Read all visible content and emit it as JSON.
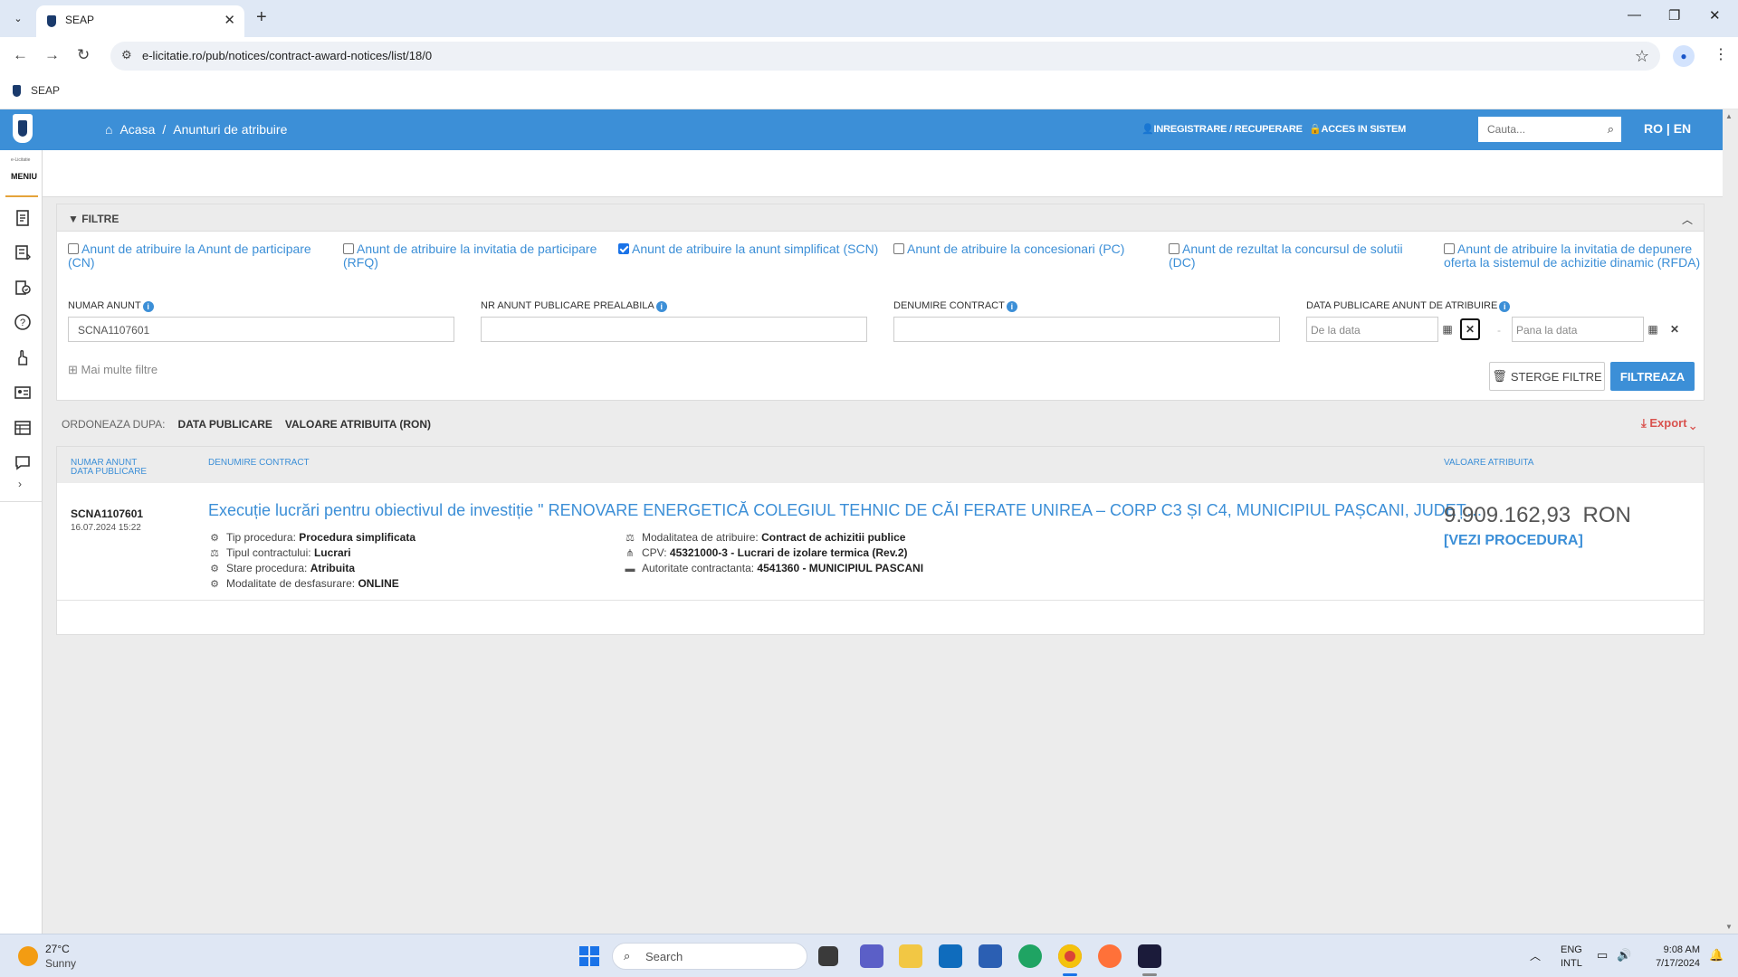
{
  "browser": {
    "tab_title": "SEAP",
    "url": "e-licitatie.ro/pub/notices/contract-award-notices/list/18/0",
    "bookmark": "SEAP"
  },
  "header": {
    "breadcrumb_home": "Acasa",
    "breadcrumb_sep": "/",
    "breadcrumb_current": "Anunturi de atribuire",
    "register_link": "INREGISTRARE / RECUPERARE",
    "login_link": "ACCES IN SISTEM",
    "search_placeholder": "Cauta...",
    "language": "RO | EN"
  },
  "sidebar": {
    "small_text": "e-Licitatie",
    "menu_label": "MENIU"
  },
  "filters": {
    "title": "FILTRE",
    "checkboxes": [
      {
        "label": "Anunt de atribuire la Anunt de participare (CN)",
        "checked": false
      },
      {
        "label": "Anunt de atribuire la invitatia de participare (RFQ)",
        "checked": false
      },
      {
        "label": "Anunt de atribuire la anunt simplificat (SCN)",
        "checked": true
      },
      {
        "label": "Anunt de atribuire la concesionari (PC)",
        "checked": false
      },
      {
        "label": "Anunt de rezultat la concursul de solutii (DC)",
        "checked": false
      },
      {
        "label": "Anunt de atribuire la invitatia de depunere oferta la sistemul de achizitie dinamic (RFDA)",
        "checked": false
      }
    ],
    "fields": {
      "numar_anunt_label": "NUMAR ANUNT",
      "numar_anunt_value": "SCNA1107601",
      "nr_prealabil_label": "NR ANUNT PUBLICARE PREALABILA",
      "nr_prealabil_value": "",
      "denumire_label": "DENUMIRE CONTRACT",
      "denumire_value": "",
      "data_label": "DATA PUBLICARE ANUNT DE ATRIBUIRE",
      "date_from_placeholder": "De la data",
      "date_to_placeholder": "Pana la data",
      "date_dash": "-"
    },
    "more_filters": "Mai multe filtre",
    "clear_button": "STERGE FILTRE",
    "filter_button": "FILTREAZA"
  },
  "sort": {
    "label": "ORDONEAZA DUPA:",
    "option1": "DATA PUBLICARE",
    "option2": "VALOARE ATRIBUITA (RON)",
    "export": "Export"
  },
  "results": {
    "col1_line1": "NUMAR ANUNT",
    "col1_line2": "DATA PUBLICARE",
    "col2": "DENUMIRE CONTRACT",
    "col3": "VALOARE ATRIBUITA",
    "rows": [
      {
        "number": "SCNA1107601",
        "date": "16.07.2024 15:22",
        "title": "Execuție lucrări pentru obiectivul de investiție \" RENOVARE ENERGETICĂ COLEGIUL TEHNIC DE CĂI FERATE UNIREA – CORP C3 ȘI C4, MUNICIPIUL PAȘCANI, JUDEȚUL IAȘI\"",
        "tip_procedura_label": "Tip procedura:",
        "tip_procedura": "Procedura simplificata",
        "tip_contract_label": "Tipul contractului:",
        "tip_contract": "Lucrari",
        "stare_label": "Stare procedura:",
        "stare": "Atribuita",
        "modalitate_desf_label": "Modalitate de desfasurare:",
        "modalitate_desf": "ONLINE",
        "modalitate_atr_label": "Modalitatea de atribuire:",
        "modalitate_atr": "Contract de achizitii publice",
        "cpv_label": "CPV:",
        "cpv": "45321000-3 - Lucrari de izolare termica (Rev.2)",
        "autoritate_label": "Autoritate contractanta:",
        "autoritate": "4541360 - MUNICIPIUL PASCANI",
        "value": "9.909.162,93",
        "currency": "RON",
        "procedure_link": "[VEZI PROCEDURA]"
      }
    ]
  },
  "taskbar": {
    "temperature": "27°C",
    "weather": "Sunny",
    "search": "Search",
    "lang_line1": "ENG",
    "lang_line2": "INTL",
    "time": "9:08 AM",
    "date": "7/17/2024"
  }
}
